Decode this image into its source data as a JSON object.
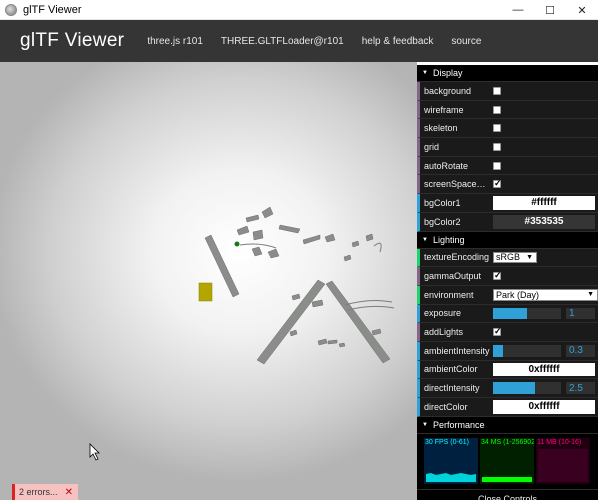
{
  "window": {
    "title": "glTF Viewer",
    "minimize": "—",
    "maximize": "☐",
    "close": "✕"
  },
  "header": {
    "brand": "glTF Viewer",
    "nav": [
      "three.js r101",
      "THREE.GLTFLoader@r101",
      "help & feedback",
      "source"
    ]
  },
  "viewport": {
    "errors": "2 errors...",
    "errors_close": "✕"
  },
  "panel": {
    "display": {
      "title": "Display",
      "background": {
        "label": "background",
        "checked": false
      },
      "wireframe": {
        "label": "wireframe",
        "checked": false
      },
      "skeleton": {
        "label": "skeleton",
        "checked": false
      },
      "grid": {
        "label": "grid",
        "checked": false
      },
      "autoRotate": {
        "label": "autoRotate",
        "checked": false
      },
      "screenSpacePanning": {
        "label": "screenSpacePan...",
        "checked": true
      },
      "bgColor1": {
        "label": "bgColor1",
        "value": "#ffffff",
        "bg": "#ffffff",
        "fg": "#000000"
      },
      "bgColor2": {
        "label": "bgColor2",
        "value": "#353535",
        "bg": "#353535",
        "fg": "#ffffff"
      }
    },
    "lighting": {
      "title": "Lighting",
      "textureEncoding": {
        "label": "textureEncoding",
        "value": "sRGB"
      },
      "gammaOutput": {
        "label": "gammaOutput",
        "checked": true
      },
      "environment": {
        "label": "environment",
        "value": "Park (Day)"
      },
      "exposure": {
        "label": "exposure",
        "value": "1",
        "fill": 0.5
      },
      "addLights": {
        "label": "addLights",
        "checked": true
      },
      "ambientIntensity": {
        "label": "ambientIntensity",
        "value": "0.3",
        "fill": 0.15
      },
      "ambientColor": {
        "label": "ambientColor",
        "value": "0xffffff"
      },
      "directIntensity": {
        "label": "directIntensity",
        "value": "2.5",
        "fill": 0.62
      },
      "directColor": {
        "label": "directColor",
        "value": "0xffffff"
      }
    },
    "performance": {
      "title": "Performance",
      "fps": {
        "text": "30 FPS (0-61)",
        "color": "#00ffff",
        "bg": "#002040"
      },
      "ms": {
        "text": "34 MS (1-25690268",
        "color": "#00ff00",
        "bg": "#002000"
      },
      "mb": {
        "text": "11 MB (10-16)",
        "color": "#ff0080",
        "bg": "#200010"
      }
    },
    "close": "Close Controls"
  },
  "colors": {
    "accent_blue": "#2fa1d6",
    "bool": "#806787",
    "option": "#1ed36f",
    "header_bg": "#353535"
  }
}
